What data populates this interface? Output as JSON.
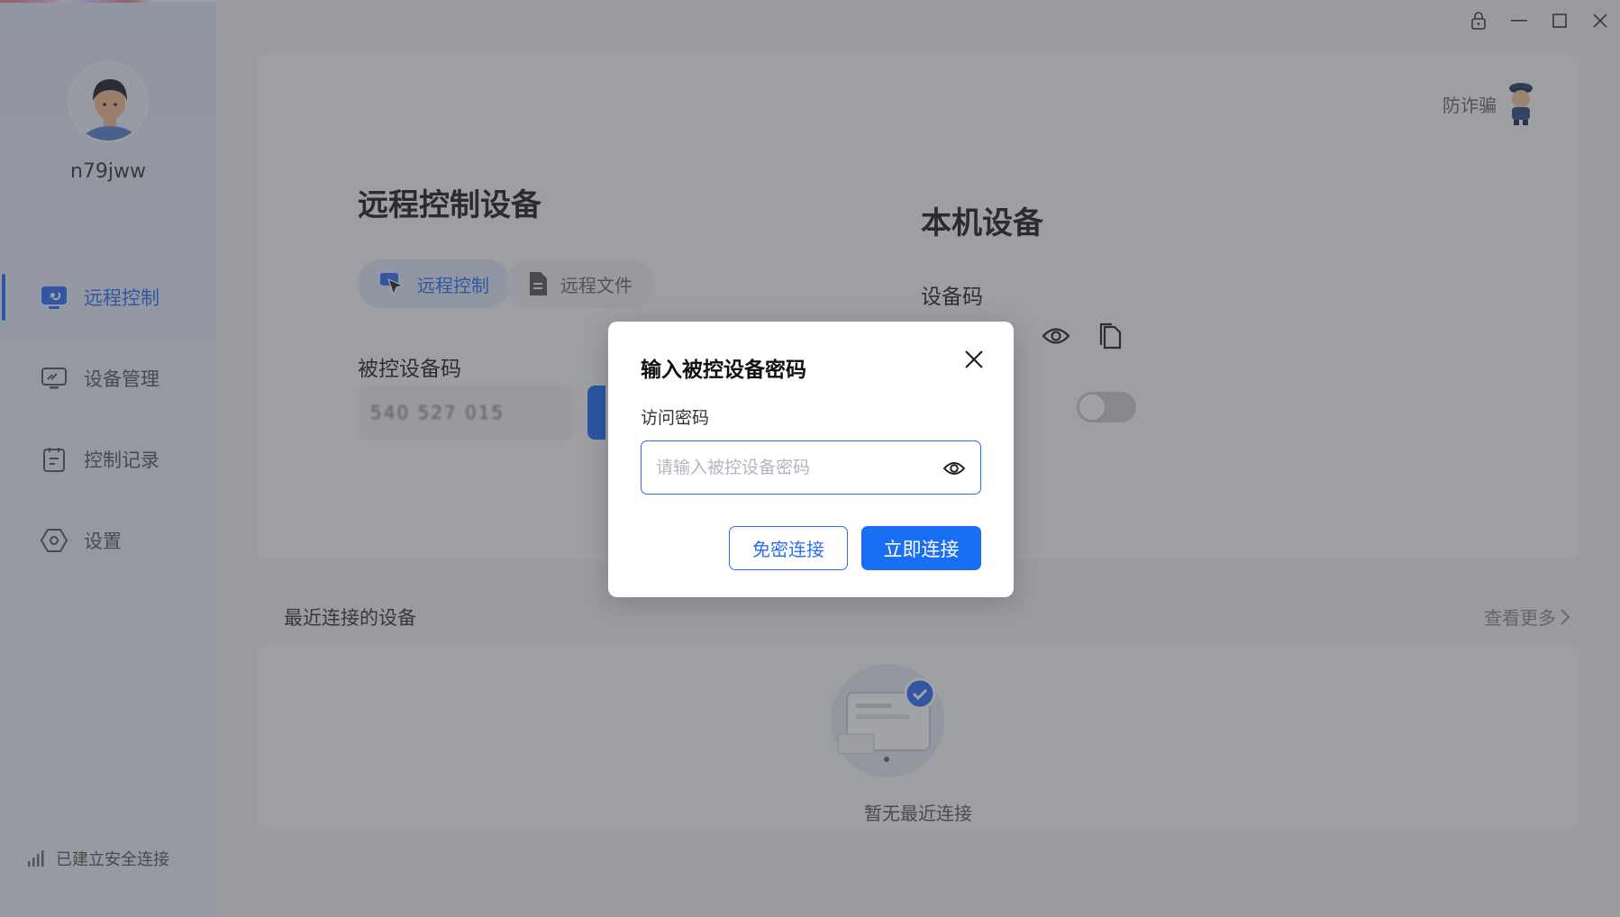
{
  "user": {
    "name": "n79jww"
  },
  "sidebar": {
    "items": [
      {
        "label": "远程控制",
        "icon": "remote-control-icon",
        "active": true
      },
      {
        "label": "设备管理",
        "icon": "device-manage-icon",
        "active": false
      },
      {
        "label": "控制记录",
        "icon": "records-icon",
        "active": false
      },
      {
        "label": "设置",
        "icon": "settings-icon",
        "active": false
      }
    ],
    "status": "已建立安全连接"
  },
  "header": {
    "antifraud": "防诈骗"
  },
  "remote": {
    "title": "远程控制设备",
    "tabs": [
      {
        "label": "远程控制",
        "active": true
      },
      {
        "label": "远程文件",
        "active": false
      }
    ],
    "code_label": "被控设备码",
    "code_value": "540 527 015"
  },
  "local": {
    "title": "本机设备",
    "code_label": "设备码"
  },
  "recent": {
    "title": "最近连接的设备",
    "see_more": "查看更多",
    "empty": "暂无最近连接"
  },
  "dialog": {
    "title": "输入被控设备密码",
    "field_label": "访问密码",
    "placeholder": "请输入被控设备密码",
    "secondary_button": "免密连接",
    "primary_button": "立即连接"
  },
  "colors": {
    "accent": "#1a6ef3",
    "active_text": "#2a6cf6",
    "overlay": "rgba(60,63,70,0.48)"
  }
}
